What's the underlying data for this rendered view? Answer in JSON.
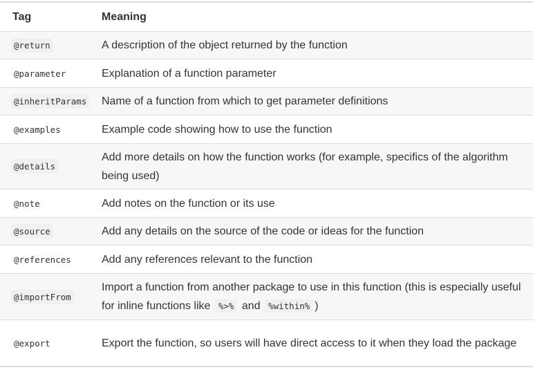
{
  "table": {
    "header": {
      "tag": "Tag",
      "meaning": "Meaning"
    },
    "rows": [
      {
        "tag": "@return",
        "meaning": "A description of the object returned by the function"
      },
      {
        "tag": "@parameter",
        "meaning": "Explanation of a function parameter"
      },
      {
        "tag": "@inheritParams",
        "meaning": "Name of a function from which to get parameter definitions"
      },
      {
        "tag": "@examples",
        "meaning": "Example code showing how to use the function"
      },
      {
        "tag": "@details",
        "meaning": "Add more details on how the function works (for example, specifics of the algorithm being used)"
      },
      {
        "tag": "@note",
        "meaning": "Add notes on the function or its use"
      },
      {
        "tag": "@source",
        "meaning": "Add any details on the source of the code or ideas for the function"
      },
      {
        "tag": "@references",
        "meaning": "Add any references relevant to the function"
      },
      {
        "tag": "@importFrom",
        "meaning_before": "Import a function from another package to use in this function (this is especially useful for inline functions like",
        "code1": "%>%",
        "meaning_mid": "and",
        "code2": "%within%",
        "meaning_after": ")"
      },
      {
        "tag": "@export",
        "meaning": "Export the function, so users will have direct access to it when they load the package"
      }
    ]
  }
}
